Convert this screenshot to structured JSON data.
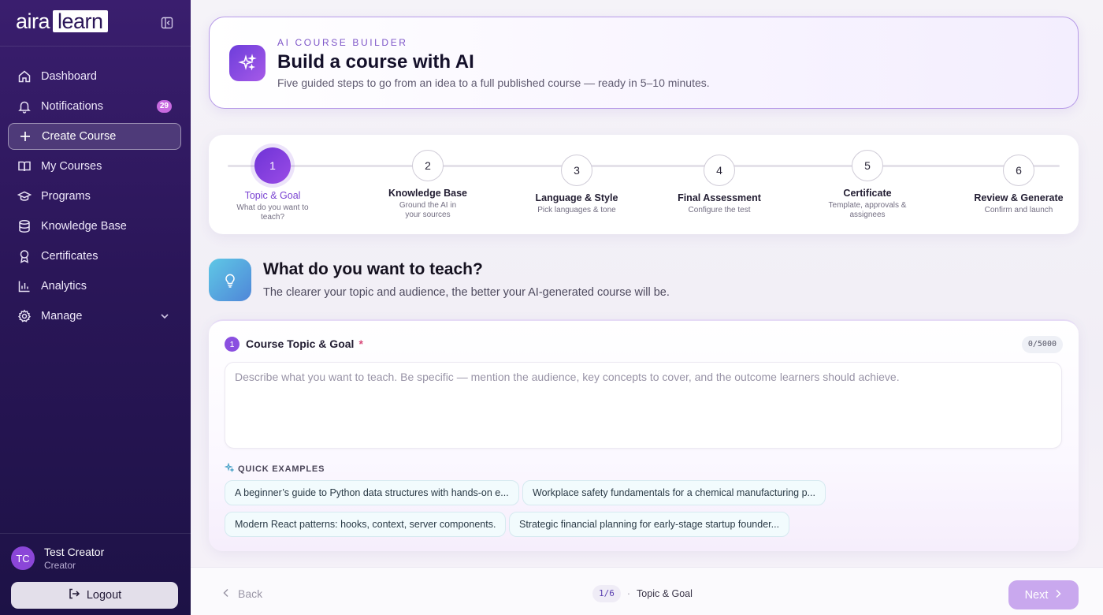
{
  "brand": {
    "part1": "aira",
    "part2": "learn"
  },
  "sidebar": {
    "items": [
      {
        "label": "Dashboard",
        "icon": "home-icon"
      },
      {
        "label": "Notifications",
        "icon": "bell-icon",
        "badge": "29"
      },
      {
        "label": "Create Course",
        "icon": "plus-icon",
        "active": true
      },
      {
        "label": "My Courses",
        "icon": "book-icon"
      },
      {
        "label": "Programs",
        "icon": "graduation-cap-icon"
      },
      {
        "label": "Knowledge Base",
        "icon": "database-icon"
      },
      {
        "label": "Certificates",
        "icon": "award-icon"
      },
      {
        "label": "Analytics",
        "icon": "bar-chart-icon"
      },
      {
        "label": "Manage",
        "icon": "gear-icon"
      }
    ],
    "user": {
      "initials": "TC",
      "name": "Test Creator",
      "role": "Creator"
    },
    "logout_label": "Logout"
  },
  "hero": {
    "eyebrow": "AI COURSE BUILDER",
    "title": "Build a course with AI",
    "subtitle": "Five guided steps to go from an idea to a full published course — ready in 5–10 minutes."
  },
  "steps": [
    {
      "num": "1",
      "title": "Topic & Goal",
      "sub": "What do you want to teach?",
      "active": true
    },
    {
      "num": "2",
      "title": "Knowledge Base",
      "sub": "Ground the AI in your sources"
    },
    {
      "num": "3",
      "title": "Language & Style",
      "sub": "Pick languages & tone"
    },
    {
      "num": "4",
      "title": "Final Assessment",
      "sub": "Configure the test"
    },
    {
      "num": "5",
      "title": "Certificate",
      "sub": "Template, approvals & assignees"
    },
    {
      "num": "6",
      "title": "Review & Generate",
      "sub": "Confirm and launch"
    }
  ],
  "question": {
    "title": "What do you want to teach?",
    "subtitle": "The clearer your topic and audience, the better your AI-generated course will be."
  },
  "field": {
    "num": "1",
    "label": "Course Topic & Goal",
    "required_mark": "*",
    "counter": "0/5000",
    "value": "",
    "placeholder": "Describe what you want to teach. Be specific — mention the audience, key concepts to cover, and the outcome learners should achieve."
  },
  "quick_examples": {
    "label": "QUICK EXAMPLES",
    "chips": [
      "A beginner’s guide to Python data structures with hands-on e...",
      "Workplace safety fundamentals for a chemical manufacturing p...",
      "Modern React patterns: hooks, context, server components.",
      "Strategic financial planning for early-stage startup founder..."
    ]
  },
  "footer": {
    "back_label": "Back",
    "progress": "1/6",
    "separator": "·",
    "current_step": "Topic & Goal",
    "next_label": "Next"
  },
  "colors": {
    "accent": "#7a44d2",
    "sidebar": "#2a1658",
    "next_disabled": "#c9a8ee"
  }
}
